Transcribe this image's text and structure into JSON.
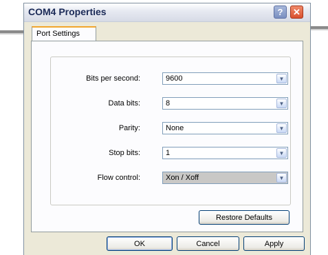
{
  "window": {
    "title": "COM4 Properties",
    "help_label": "?",
    "close_label": "✕"
  },
  "tabs": [
    {
      "label": "Port Settings",
      "active": true
    }
  ],
  "settings": [
    {
      "label": "Bits per second:",
      "value": "9600"
    },
    {
      "label": "Data bits:",
      "value": "8"
    },
    {
      "label": "Parity:",
      "value": "None"
    },
    {
      "label": "Stop bits:",
      "value": "1"
    },
    {
      "label": "Flow control:",
      "value": "Xon / Xoff",
      "selected": true
    }
  ],
  "dropdown_arrow": "▼",
  "buttons": {
    "restore_defaults": "Restore Defaults",
    "ok": "OK",
    "cancel": "Cancel",
    "apply": "Apply"
  },
  "colors": {
    "title_text": "#1b2a57",
    "tab_accent": "#f2a62c",
    "close_button": "#d9502f",
    "dialog_bg": "#ece9d8"
  }
}
